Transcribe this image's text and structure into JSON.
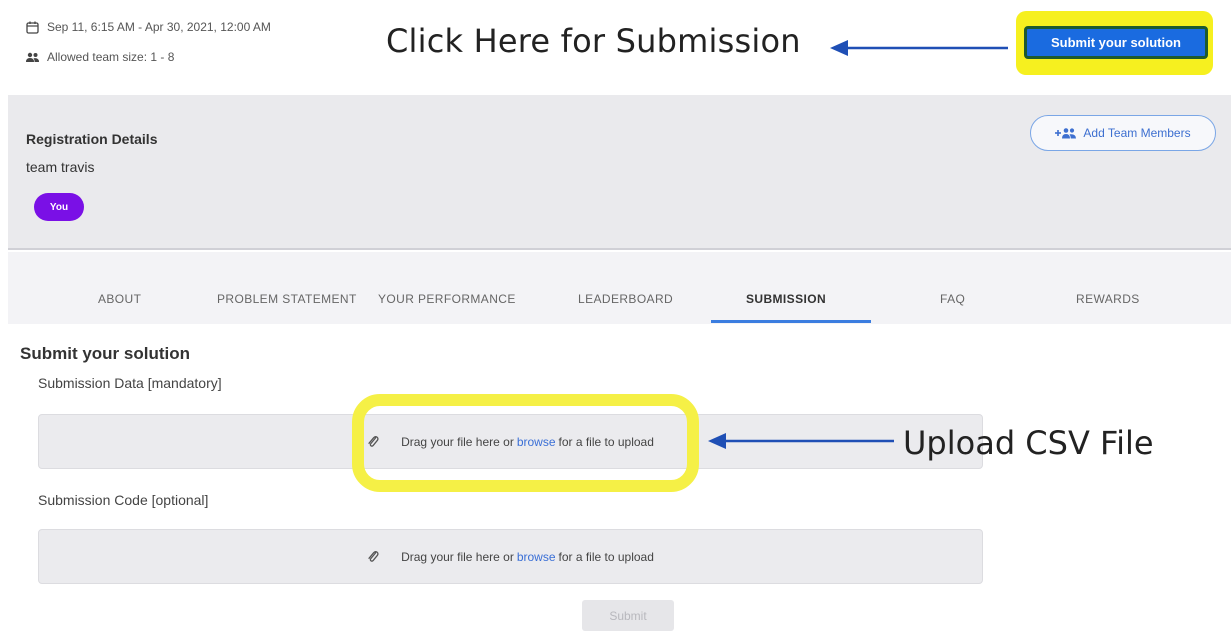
{
  "header": {
    "date_range": "Sep 11, 6:15 AM - Apr 30, 2021, 12:00 AM",
    "team_size": "Allowed team size: 1 - 8",
    "submit_button_label": "Submit your solution",
    "callout_submission": "Click Here for Submission"
  },
  "registration": {
    "title": "Registration Details",
    "team_name": "team travis",
    "you_badge": "You",
    "add_team_members_label": "Add Team Members"
  },
  "tabs": [
    {
      "label": "ABOUT",
      "active": false
    },
    {
      "label": "PROBLEM STATEMENT",
      "active": false
    },
    {
      "label": "YOUR PERFORMANCE",
      "active": false
    },
    {
      "label": "LEADERBOARD",
      "active": false
    },
    {
      "label": "SUBMISSION",
      "active": true
    },
    {
      "label": "FAQ",
      "active": false
    },
    {
      "label": "REWARDS",
      "active": false
    }
  ],
  "submission": {
    "section_title": "Submit your solution",
    "data_field": {
      "label": "Submission Data [mandatory]",
      "drop_prefix": "Drag your file here or",
      "browse": "browse",
      "drop_suffix": "for a file to upload"
    },
    "code_field": {
      "label": "Submission Code [optional]",
      "drop_prefix": "Drag your file here or",
      "browse": "browse",
      "drop_suffix": "for a file to upload"
    },
    "submit_label": "Submit",
    "callout_csv": "Upload CSV File"
  },
  "colors": {
    "primary_blue": "#1a6be0",
    "highlight_yellow": "#f6f01f",
    "badge_purple": "#7a10e6",
    "arrow_blue": "#1f4fb5",
    "link_blue": "#3a6fd6"
  },
  "icons": {
    "date": "calendar-icon",
    "team": "people-icon",
    "add_member": "add-people-icon",
    "attach": "paperclip-icon",
    "arrow": "arrow-left-icon"
  }
}
